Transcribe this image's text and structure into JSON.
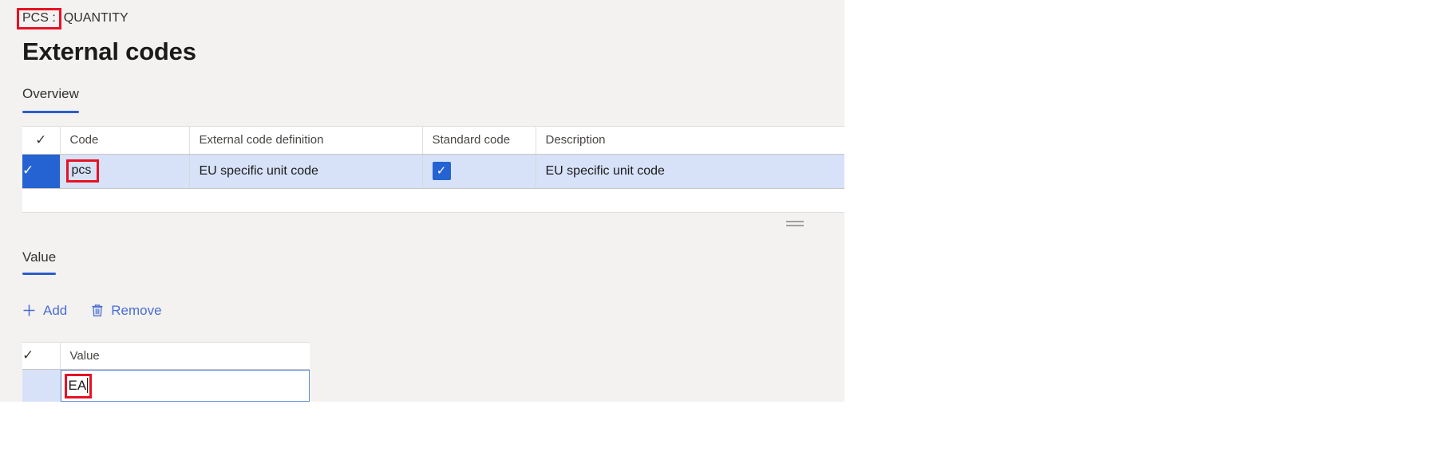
{
  "breadcrumb": {
    "highlighted": "PCS :",
    "rest": "QUANTITY"
  },
  "page_title": "External codes",
  "overview_section": {
    "tabs": [
      {
        "label": "Overview",
        "active": true
      }
    ],
    "grid": {
      "columns": [
        "",
        "Code",
        "External code definition",
        "Standard code",
        "Description"
      ],
      "header_select_icon": "checkmark-icon",
      "rows": [
        {
          "selected": true,
          "code": "pcs",
          "external_code_definition": "EU specific unit code",
          "standard_code_checked": true,
          "description": "EU specific unit code"
        }
      ]
    }
  },
  "resize_grip": "resize-handle-icon",
  "value_section": {
    "tabs": [
      {
        "label": "Value",
        "active": true
      }
    ],
    "toolbar": {
      "add_label": "Add",
      "add_icon": "plus-icon",
      "remove_label": "Remove",
      "remove_icon": "trash-icon"
    },
    "grid": {
      "columns": [
        "",
        "Value"
      ],
      "header_select_icon": "checkmark-icon",
      "rows": [
        {
          "selected": true,
          "editing": true,
          "value": "EA"
        }
      ]
    }
  },
  "colors": {
    "accent": "#2463d1",
    "tab_underline": "#2b5ecc",
    "row_selected_bg": "#d7e2f8",
    "link": "#4a6ed4",
    "annotation": "#e81123",
    "panel_bg": "#f3f2f1"
  }
}
